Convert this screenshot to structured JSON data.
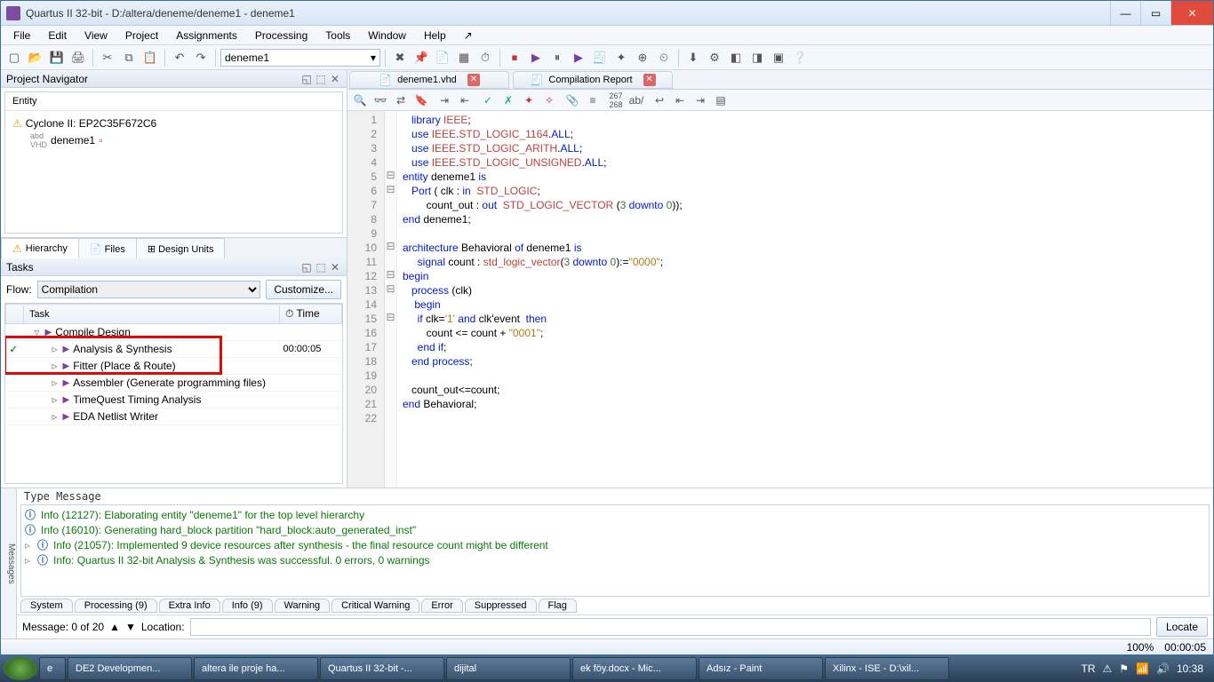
{
  "window": {
    "title": "Quartus II 32-bit - D:/altera/deneme/deneme1 - deneme1"
  },
  "menu": [
    "File",
    "Edit",
    "View",
    "Project",
    "Assignments",
    "Processing",
    "Tools",
    "Window",
    "Help"
  ],
  "toolbar_combo": "deneme1",
  "project_navigator": {
    "title": "Project Navigator",
    "entity_header": "Entity",
    "device": "Cyclone II: EP2C35F672C6",
    "entity": "deneme1",
    "tabs": [
      "Hierarchy",
      "Files",
      "Design Units"
    ]
  },
  "tasks": {
    "title": "Tasks",
    "flow_label": "Flow:",
    "flow_value": "Compilation",
    "customize": "Customize...",
    "cols": [
      "Task",
      "Time"
    ],
    "time_icon": "⏱",
    "rows": [
      {
        "indent": 0,
        "exp": "▿",
        "icon": "▶",
        "label": "Compile Design",
        "time": "",
        "status": ""
      },
      {
        "indent": 1,
        "exp": "▹",
        "icon": "▶",
        "label": "Analysis & Synthesis",
        "time": "00:00:05",
        "status": "✓",
        "highlighted": true
      },
      {
        "indent": 1,
        "exp": "▹",
        "icon": "▶",
        "label": "Fitter (Place & Route)",
        "time": "",
        "status": ""
      },
      {
        "indent": 1,
        "exp": "▹",
        "icon": "▶",
        "label": "Assembler (Generate programming files)",
        "time": "",
        "status": ""
      },
      {
        "indent": 1,
        "exp": "▹",
        "icon": "▶",
        "label": "TimeQuest Timing Analysis",
        "time": "",
        "status": ""
      },
      {
        "indent": 1,
        "exp": "▹",
        "icon": "▶",
        "label": "EDA Netlist Writer",
        "time": "",
        "status": ""
      }
    ]
  },
  "doc_tabs": [
    {
      "label": "deneme1.vhd",
      "closable": true
    },
    {
      "label": "Compilation Report",
      "closable": true
    }
  ],
  "code_lines": [
    {
      "n": 1,
      "fold": "",
      "html": "   <span class='kw'>library</span> <span class='type'>IEEE</span>;"
    },
    {
      "n": 2,
      "fold": "",
      "html": "   <span class='kw'>use</span> <span class='type'>IEEE</span>.<span class='type'>STD_LOGIC_1164</span>.<span class='kw'>ALL</span>;"
    },
    {
      "n": 3,
      "fold": "",
      "html": "   <span class='kw'>use</span> <span class='type'>IEEE</span>.<span class='type'>STD_LOGIC_ARITH</span>.<span class='kw'>ALL</span>;"
    },
    {
      "n": 4,
      "fold": "",
      "html": "   <span class='kw'>use</span> <span class='type'>IEEE</span>.<span class='type'>STD_LOGIC_UNSIGNED</span>.<span class='kw'>ALL</span>;"
    },
    {
      "n": 5,
      "fold": "⊟",
      "html": "<span class='kw'>entity</span> deneme1 <span class='kw'>is</span>"
    },
    {
      "n": 6,
      "fold": "⊟",
      "html": "   <span class='kw'>Port</span> ( clk : <span class='kw'>in</span>  <span class='type'>STD_LOGIC</span>;"
    },
    {
      "n": 7,
      "fold": "",
      "html": "        count_out : <span class='kw'>out</span>  <span class='type'>STD_LOGIC_VECTOR</span> (<span class='num'>3</span> <span class='kw'>downto</span> <span class='num'>0</span>));"
    },
    {
      "n": 8,
      "fold": "",
      "html": "<span class='kw'>end</span> deneme1;"
    },
    {
      "n": 9,
      "fold": "",
      "html": ""
    },
    {
      "n": 10,
      "fold": "⊟",
      "html": "<span class='kw'>architecture</span> Behavioral <span class='kw'>of</span> deneme1 <span class='kw'>is</span>"
    },
    {
      "n": 11,
      "fold": "",
      "html": "     <span class='kw'>signal</span> count : <span class='type'>std_logic_vector</span>(<span class='num'>3</span> <span class='kw'>downto</span> <span class='num'>0</span>):=<span class='str'>\"0000\"</span>;"
    },
    {
      "n": 12,
      "fold": "⊟",
      "html": "<span class='kw'>begin</span>"
    },
    {
      "n": 13,
      "fold": "⊟",
      "html": "   <span class='kw'>process</span> (clk)"
    },
    {
      "n": 14,
      "fold": "",
      "html": "    <span class='kw'>begin</span>"
    },
    {
      "n": 15,
      "fold": "⊟",
      "html": "     <span class='kw'>if</span> clk=<span class='str'>'1'</span> <span class='kw'>and</span> clk'event  <span class='kw'>then</span>"
    },
    {
      "n": 16,
      "fold": "",
      "html": "        count &lt;= count + <span class='str'>\"0001\"</span>;"
    },
    {
      "n": 17,
      "fold": "",
      "html": "     <span class='kw'>end</span> <span class='kw'>if</span>;"
    },
    {
      "n": 18,
      "fold": "",
      "html": "   <span class='kw'>end</span> <span class='kw'>process</span>;"
    },
    {
      "n": 19,
      "fold": "",
      "html": ""
    },
    {
      "n": 20,
      "fold": "",
      "html": "   count_out&lt;=count;"
    },
    {
      "n": 21,
      "fold": "",
      "html": "<span class='kw'>end</span> Behavioral;"
    },
    {
      "n": 22,
      "fold": "",
      "html": ""
    }
  ],
  "messages": {
    "side_label": "Messages",
    "header": "Type Message",
    "rows": [
      "Info (12127): Elaborating entity \"deneme1\" for the top level hierarchy",
      "Info (16010): Generating hard_block partition \"hard_block:auto_generated_inst\"",
      "Info (21057): Implemented 9 device resources after synthesis - the final resource count might be different",
      "Info: Quartus II 32-bit Analysis & Synthesis was successful. 0 errors, 0 warnings"
    ],
    "tabs": [
      "System",
      "Processing (9)",
      "Extra Info",
      "Info (9)",
      "Warning",
      "Critical Warning",
      "Error",
      "Suppressed",
      "Flag"
    ],
    "footer_label": "Message: 0 of 20",
    "location_label": "Location:",
    "locate": "Locate"
  },
  "statusbar": {
    "zoom": "100%",
    "time": "00:00:05"
  },
  "taskbar": {
    "items": [
      "DE2 Developmen...",
      "altera ile proje ha...",
      "Quartus II 32-bit -...",
      "dijital",
      "ek föy.docx - Mic...",
      "Adsız - Paint",
      "Xilinx - ISE - D:\\xil..."
    ],
    "lang": "TR",
    "clock": "10:38"
  }
}
